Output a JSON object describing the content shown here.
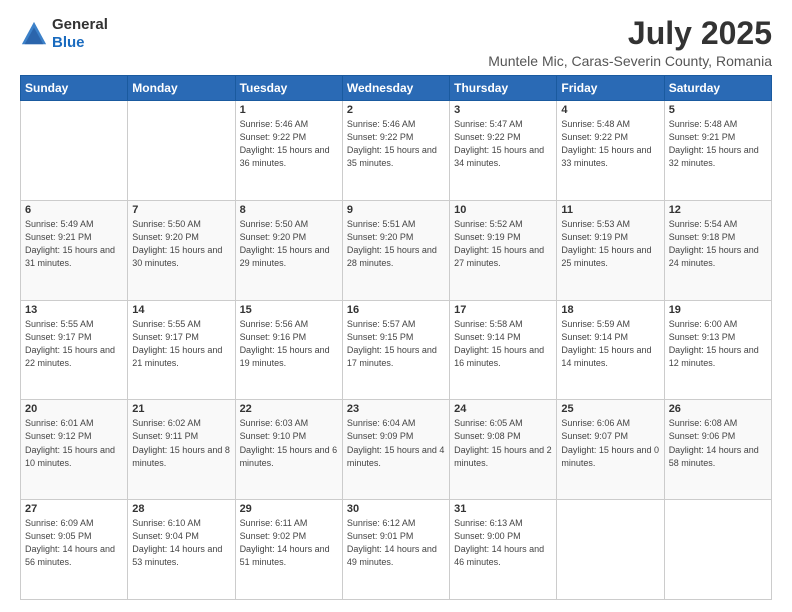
{
  "header": {
    "logo_general": "General",
    "logo_blue": "Blue",
    "month_year": "July 2025",
    "location": "Muntele Mic, Caras-Severin County, Romania"
  },
  "calendar": {
    "days_of_week": [
      "Sunday",
      "Monday",
      "Tuesday",
      "Wednesday",
      "Thursday",
      "Friday",
      "Saturday"
    ],
    "weeks": [
      [
        {
          "day": "",
          "info": ""
        },
        {
          "day": "",
          "info": ""
        },
        {
          "day": "1",
          "info": "Sunrise: 5:46 AM\nSunset: 9:22 PM\nDaylight: 15 hours and 36 minutes."
        },
        {
          "day": "2",
          "info": "Sunrise: 5:46 AM\nSunset: 9:22 PM\nDaylight: 15 hours and 35 minutes."
        },
        {
          "day": "3",
          "info": "Sunrise: 5:47 AM\nSunset: 9:22 PM\nDaylight: 15 hours and 34 minutes."
        },
        {
          "day": "4",
          "info": "Sunrise: 5:48 AM\nSunset: 9:22 PM\nDaylight: 15 hours and 33 minutes."
        },
        {
          "day": "5",
          "info": "Sunrise: 5:48 AM\nSunset: 9:21 PM\nDaylight: 15 hours and 32 minutes."
        }
      ],
      [
        {
          "day": "6",
          "info": "Sunrise: 5:49 AM\nSunset: 9:21 PM\nDaylight: 15 hours and 31 minutes."
        },
        {
          "day": "7",
          "info": "Sunrise: 5:50 AM\nSunset: 9:20 PM\nDaylight: 15 hours and 30 minutes."
        },
        {
          "day": "8",
          "info": "Sunrise: 5:50 AM\nSunset: 9:20 PM\nDaylight: 15 hours and 29 minutes."
        },
        {
          "day": "9",
          "info": "Sunrise: 5:51 AM\nSunset: 9:20 PM\nDaylight: 15 hours and 28 minutes."
        },
        {
          "day": "10",
          "info": "Sunrise: 5:52 AM\nSunset: 9:19 PM\nDaylight: 15 hours and 27 minutes."
        },
        {
          "day": "11",
          "info": "Sunrise: 5:53 AM\nSunset: 9:19 PM\nDaylight: 15 hours and 25 minutes."
        },
        {
          "day": "12",
          "info": "Sunrise: 5:54 AM\nSunset: 9:18 PM\nDaylight: 15 hours and 24 minutes."
        }
      ],
      [
        {
          "day": "13",
          "info": "Sunrise: 5:55 AM\nSunset: 9:17 PM\nDaylight: 15 hours and 22 minutes."
        },
        {
          "day": "14",
          "info": "Sunrise: 5:55 AM\nSunset: 9:17 PM\nDaylight: 15 hours and 21 minutes."
        },
        {
          "day": "15",
          "info": "Sunrise: 5:56 AM\nSunset: 9:16 PM\nDaylight: 15 hours and 19 minutes."
        },
        {
          "day": "16",
          "info": "Sunrise: 5:57 AM\nSunset: 9:15 PM\nDaylight: 15 hours and 17 minutes."
        },
        {
          "day": "17",
          "info": "Sunrise: 5:58 AM\nSunset: 9:14 PM\nDaylight: 15 hours and 16 minutes."
        },
        {
          "day": "18",
          "info": "Sunrise: 5:59 AM\nSunset: 9:14 PM\nDaylight: 15 hours and 14 minutes."
        },
        {
          "day": "19",
          "info": "Sunrise: 6:00 AM\nSunset: 9:13 PM\nDaylight: 15 hours and 12 minutes."
        }
      ],
      [
        {
          "day": "20",
          "info": "Sunrise: 6:01 AM\nSunset: 9:12 PM\nDaylight: 15 hours and 10 minutes."
        },
        {
          "day": "21",
          "info": "Sunrise: 6:02 AM\nSunset: 9:11 PM\nDaylight: 15 hours and 8 minutes."
        },
        {
          "day": "22",
          "info": "Sunrise: 6:03 AM\nSunset: 9:10 PM\nDaylight: 15 hours and 6 minutes."
        },
        {
          "day": "23",
          "info": "Sunrise: 6:04 AM\nSunset: 9:09 PM\nDaylight: 15 hours and 4 minutes."
        },
        {
          "day": "24",
          "info": "Sunrise: 6:05 AM\nSunset: 9:08 PM\nDaylight: 15 hours and 2 minutes."
        },
        {
          "day": "25",
          "info": "Sunrise: 6:06 AM\nSunset: 9:07 PM\nDaylight: 15 hours and 0 minutes."
        },
        {
          "day": "26",
          "info": "Sunrise: 6:08 AM\nSunset: 9:06 PM\nDaylight: 14 hours and 58 minutes."
        }
      ],
      [
        {
          "day": "27",
          "info": "Sunrise: 6:09 AM\nSunset: 9:05 PM\nDaylight: 14 hours and 56 minutes."
        },
        {
          "day": "28",
          "info": "Sunrise: 6:10 AM\nSunset: 9:04 PM\nDaylight: 14 hours and 53 minutes."
        },
        {
          "day": "29",
          "info": "Sunrise: 6:11 AM\nSunset: 9:02 PM\nDaylight: 14 hours and 51 minutes."
        },
        {
          "day": "30",
          "info": "Sunrise: 6:12 AM\nSunset: 9:01 PM\nDaylight: 14 hours and 49 minutes."
        },
        {
          "day": "31",
          "info": "Sunrise: 6:13 AM\nSunset: 9:00 PM\nDaylight: 14 hours and 46 minutes."
        },
        {
          "day": "",
          "info": ""
        },
        {
          "day": "",
          "info": ""
        }
      ]
    ]
  }
}
